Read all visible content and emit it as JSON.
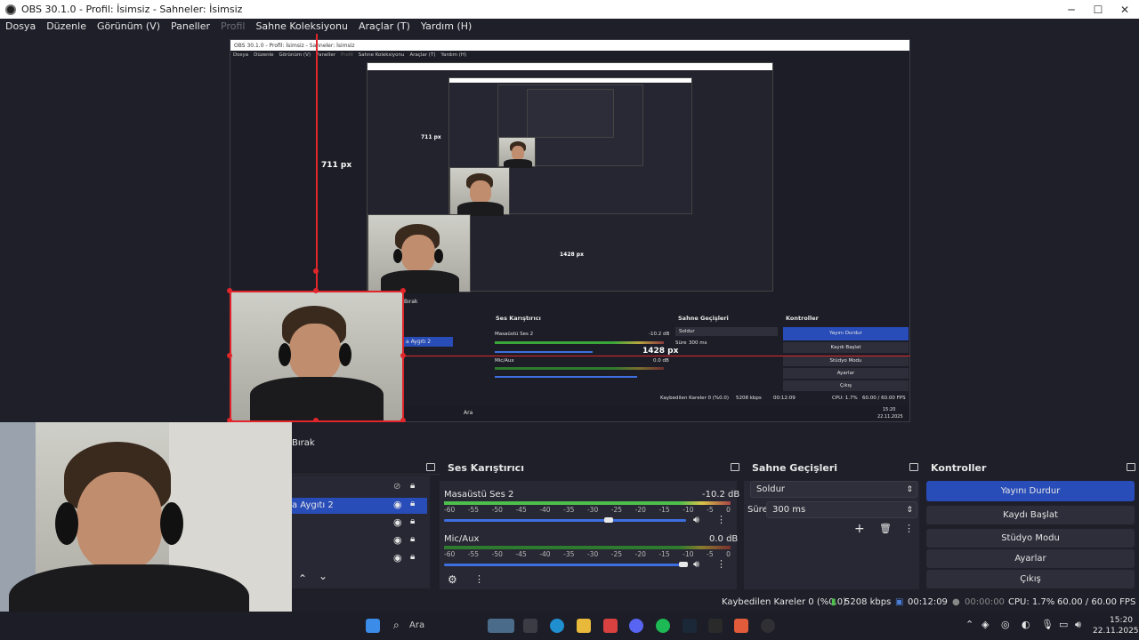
{
  "window": {
    "title": "OBS 30.1.0 - Profil: İsimsiz - Sahneler: İsimsiz",
    "minimize": "─",
    "maximize": "☐",
    "close": "✕"
  },
  "menu": {
    "items": [
      "Dosya",
      "Düzenle",
      "Görünüm (V)",
      "Paneller",
      "Profil",
      "Sahne Koleksiyonu",
      "Araçlar (T)",
      "Yardım (H)"
    ],
    "disabled_index": 4
  },
  "preview": {
    "inner_title": "OBS 30.1.0 - Profil: İsimsiz - Sahneler: İsimsiz",
    "inner_menu": [
      "Dosya",
      "Düzenle",
      "Görünüm (V)",
      "Paneller",
      "Profil",
      "Sahne Koleksiyonu",
      "Araçlar (T)",
      "Yardım (H)"
    ],
    "label_711": "711 px",
    "label_1428": "1428 px",
    "nested_1428": "1428 px",
    "nested_711": "711 px",
    "inner_stop_label": "Bırak",
    "inner_source": "a Aygıtı 2",
    "inner_mixer_title": "Ses Karıştırıcı",
    "inner_trans_title": "Sahne Geçişleri",
    "inner_ctrl_title": "Kontroller",
    "inner_desktop": "Masaüstü Ses 2",
    "inner_desktop_db": "-10.2 dB",
    "inner_mic": "Mic/Aux",
    "inner_mic_db": "0.0 dB",
    "inner_fade": "Soldur",
    "inner_dur_label": "Süre",
    "inner_dur": "300 ms",
    "inner_buttons": [
      "Yayını Durdur",
      "Kaydı Başlat",
      "Stüdyo Modu",
      "Ayarlar",
      "Çıkış"
    ],
    "inner_status": "Kaybedilen Kareler 0 (%0.0)",
    "inner_kbps": "5208 kbps",
    "inner_time": "00:12:09",
    "inner_cpu": "CPU: 1.7%",
    "inner_fps": "60.00 / 60.00 FPS",
    "inner_search": "Ara",
    "inner_clock": "15:20",
    "inner_date": "22.11.2025"
  },
  "sources": {
    "stop_label": "Bırak",
    "selected_item": "a Aygıtı 2",
    "up": "⌃",
    "down": "⌄"
  },
  "mixer": {
    "title": "Ses Karıştırıcı",
    "channels": [
      {
        "name": "Masaüstü Ses 2",
        "db": "-10.2 dB",
        "volume": 0.68
      },
      {
        "name": "Mic/Aux",
        "db": "0.0 dB",
        "volume": 1.0
      }
    ],
    "scale": [
      "-60",
      "-55",
      "-50",
      "-45",
      "-40",
      "-35",
      "-30",
      "-25",
      "-20",
      "-15",
      "-10",
      "-5",
      "0"
    ]
  },
  "transitions": {
    "title": "Sahne Geçişleri",
    "type": "Soldur",
    "duration_label": "Süre",
    "duration": "300 ms"
  },
  "controls": {
    "title": "Kontroller",
    "buttons": [
      "Yayını Durdur",
      "Kaydı Başlat",
      "Stüdyo Modu",
      "Ayarlar",
      "Çıkış"
    ]
  },
  "status": {
    "dropped": "Kaybedilen Kareler 0 (%0.0)",
    "bitrate": "5208 kbps",
    "stream_time": "00:12:09",
    "rec_time": "00:00:00",
    "cpu": "CPU: 1.7%",
    "fps": "60.00 / 60.00 FPS"
  },
  "taskbar": {
    "search_placeholder": "Ara",
    "time": "15:20",
    "date": "22.11.2025"
  },
  "colors": {
    "accent": "#284cb8",
    "guide_red": "#e0262b",
    "bg": "#1e1f29"
  }
}
